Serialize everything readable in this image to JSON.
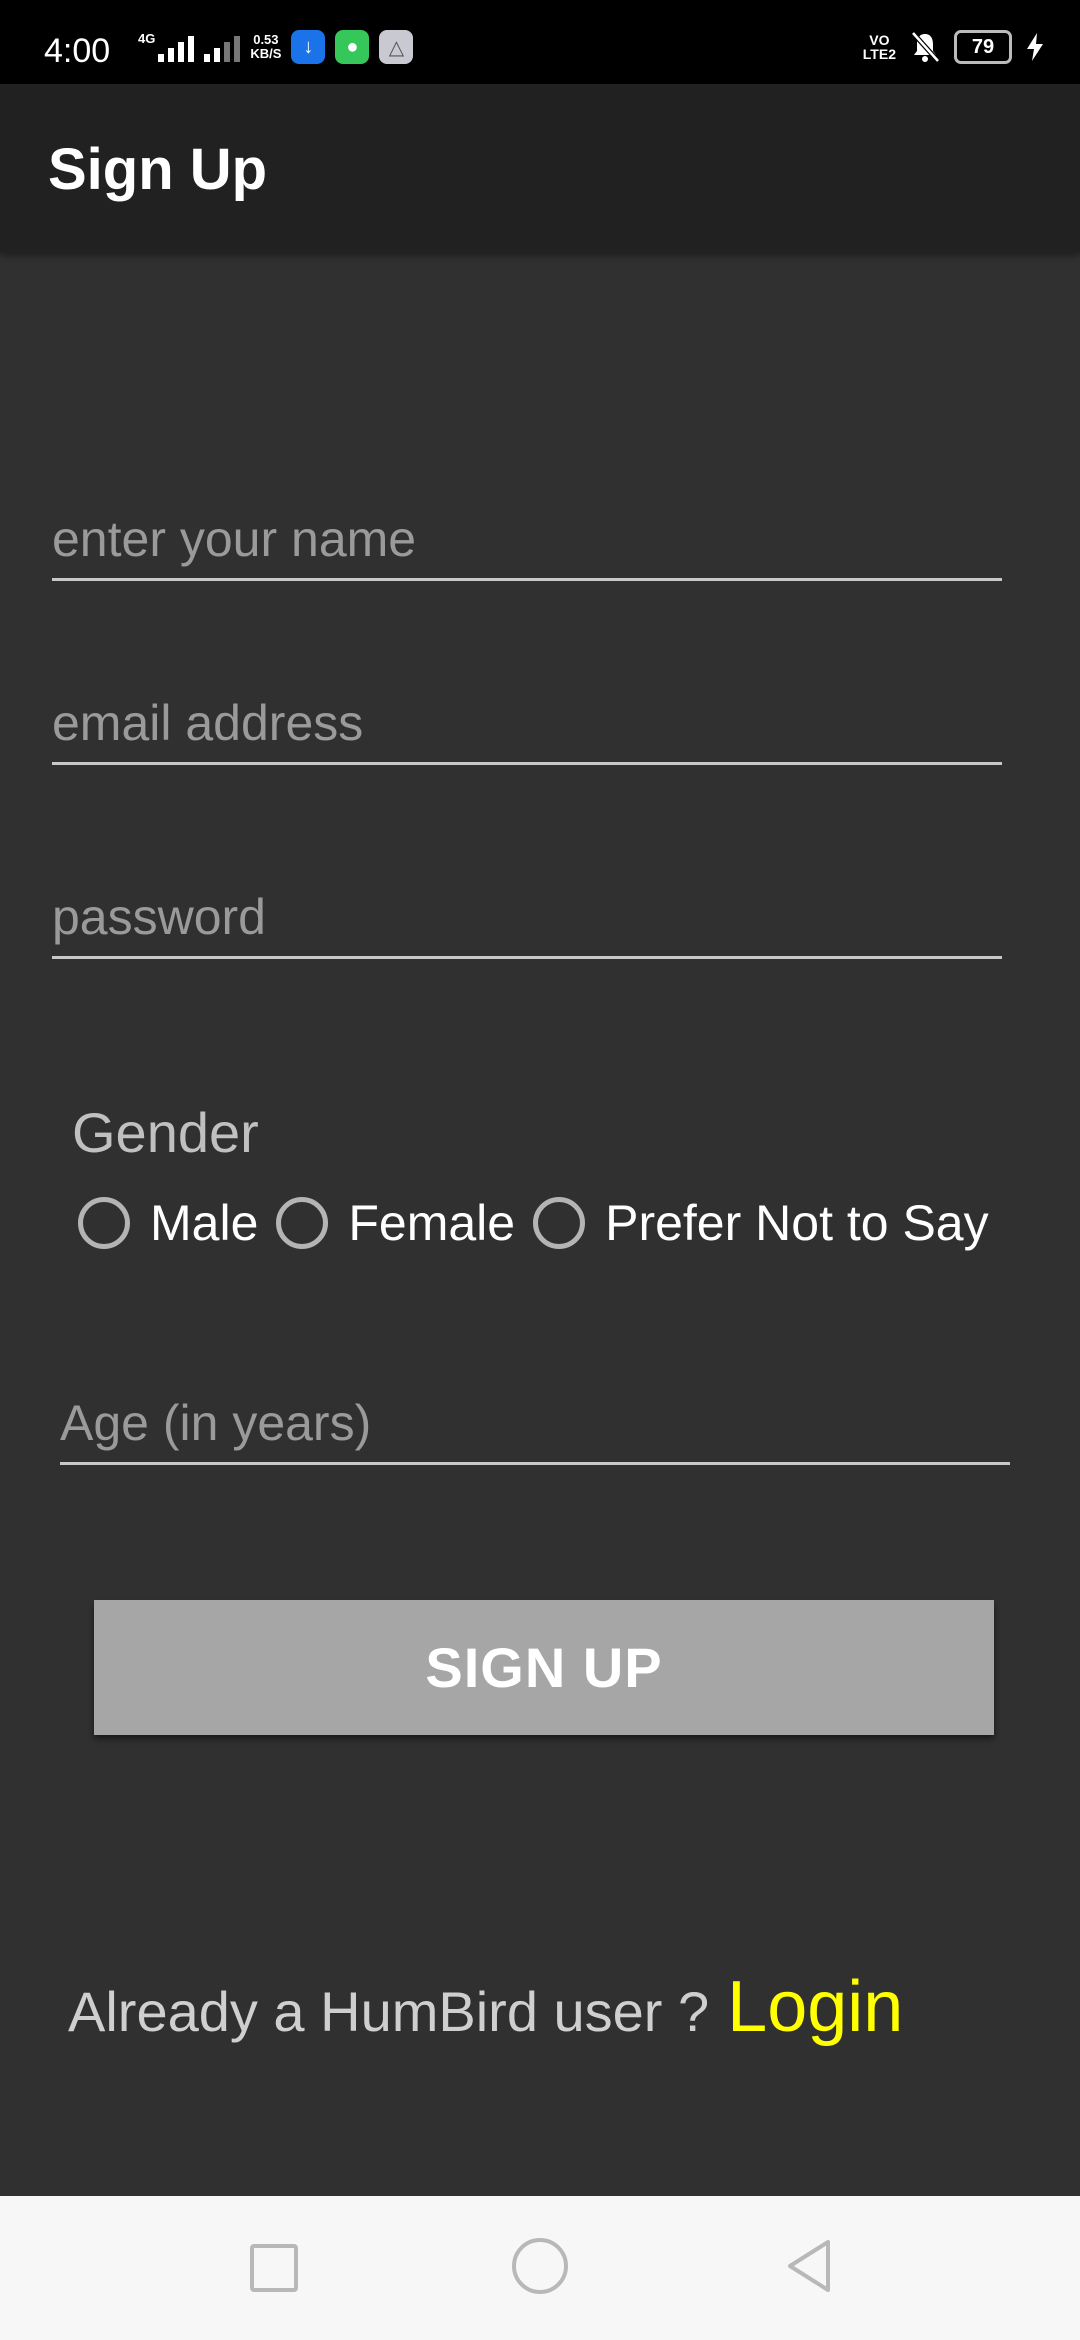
{
  "status_bar": {
    "time": "4:00",
    "network_type": "4G",
    "data_speed_value": "0.53",
    "data_speed_unit": "KB/S",
    "volte": "VO\nLTE2",
    "battery": "79"
  },
  "app_bar": {
    "title": "Sign Up"
  },
  "form": {
    "name_placeholder": "enter your name",
    "email_placeholder": "email address",
    "password_placeholder": "password",
    "gender_label": "Gender",
    "gender_options": [
      "Male",
      "Female",
      "Prefer Not to Say"
    ],
    "age_placeholder": "Age (in years)",
    "signup_label": "SIGN UP"
  },
  "footer": {
    "login_prompt": "Already a HumBird user ?",
    "login_link": "Login"
  },
  "colors": {
    "background": "#303030",
    "app_bar": "#212121",
    "button": "#a6a6a6",
    "login_link": "#ffff00"
  }
}
